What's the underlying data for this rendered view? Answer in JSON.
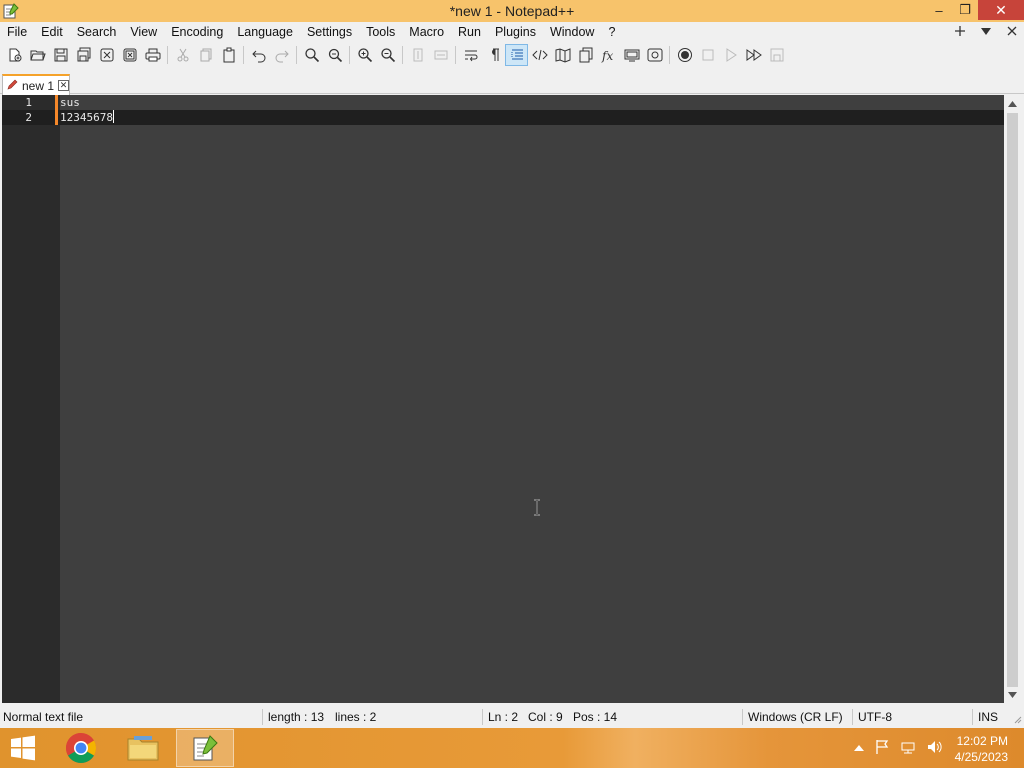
{
  "window": {
    "title": "*new 1 - Notepad++",
    "controls": {
      "minimize": "‒",
      "restore": "❐",
      "close": "✕"
    }
  },
  "menu": {
    "items": [
      "File",
      "Edit",
      "Search",
      "View",
      "Encoding",
      "Language",
      "Settings",
      "Tools",
      "Macro",
      "Run",
      "Plugins",
      "Window",
      "?"
    ],
    "right_icons": [
      "plus-icon",
      "dropdown-triangle-icon",
      "close-x-icon"
    ]
  },
  "toolbar": {
    "groups": [
      [
        "new-file-icon",
        "open-file-icon",
        "save-icon",
        "save-all-icon",
        "close-icon",
        "close-all-icon",
        "print-icon"
      ],
      [
        "cut-icon",
        "copy-icon",
        "paste-icon"
      ],
      [
        "undo-icon",
        "redo-icon"
      ],
      [
        "find-icon",
        "replace-icon"
      ],
      [
        "zoom-in-icon",
        "zoom-out-icon"
      ],
      [
        "sync-vertical-icon",
        "sync-horizontal-icon"
      ],
      [
        "word-wrap-icon",
        "show-all-chars-icon",
        "indent-guide-icon",
        "html-tag-icon",
        "document-map-icon",
        "document-list-icon",
        "function-list-icon",
        "folder-as-workspace-icon",
        "monitoring-icon"
      ],
      [
        "record-macro-icon",
        "stop-record-icon",
        "play-macro-icon",
        "run-macro-multiple-icon",
        "save-macro-icon"
      ]
    ],
    "active_icon": "indent-guide-icon"
  },
  "tabs": [
    {
      "label": "new 1",
      "icon": "pencil-modified-icon",
      "close": "✕"
    }
  ],
  "editor": {
    "lines": [
      {
        "number": "1",
        "text": "sus"
      },
      {
        "number": "2",
        "text": "12345678"
      }
    ],
    "current_line": 2
  },
  "statusbar": {
    "file_type": "Normal text file",
    "length": "length : 13",
    "lines": "lines : 2",
    "ln": "Ln : 2",
    "col": "Col : 9",
    "pos": "Pos : 14",
    "eol": "Windows (CR LF)",
    "encoding": "UTF-8",
    "mode": "INS"
  },
  "taskbar": {
    "apps": [
      "windows-start-icon",
      "chrome-icon",
      "file-explorer-icon",
      "notepad-plus-plus-icon"
    ],
    "active_app": "notepad-plus-plus-icon",
    "tray_icons": [
      "show-hidden-icons-icon",
      "action-center-flag-icon",
      "network-icon",
      "volume-icon"
    ],
    "time": "12:02 PM",
    "date": "4/25/2023"
  },
  "colors": {
    "titlebar": "#f7c36b",
    "editor_bg": "#3f3f3f",
    "gutter_bg": "#2b2b2b",
    "current_line_bg": "#1f1f1f",
    "modified_marker": "#f5882a",
    "taskbar": "#e0932d"
  }
}
